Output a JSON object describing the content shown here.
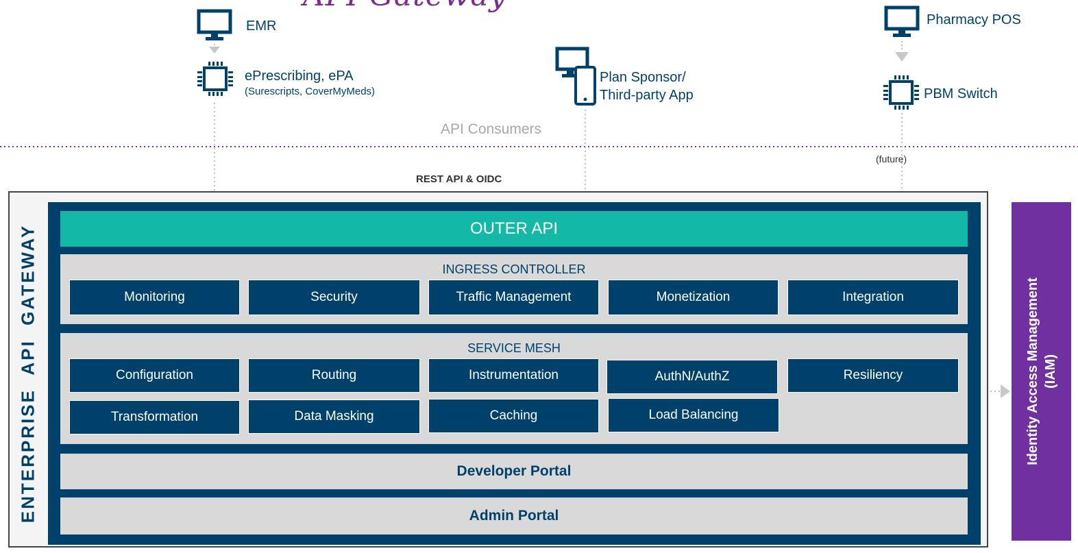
{
  "title": "API Gateway",
  "consumers": {
    "emr": "EMR",
    "eprescribing": "ePrescribing, ePA",
    "eprescribing_sub": "(Surescripts, CoverMyMeds)",
    "plan_sponsor_line1": "Plan Sponsor/",
    "plan_sponsor_line2": "Third-party App",
    "pharmacy_pos": "Pharmacy POS",
    "pbm_switch": "PBM Switch",
    "section_label": "API Consumers",
    "future_note": "(future)"
  },
  "rest_label": "REST API & OIDC",
  "gateway": {
    "vertical_label": "ENTERPRISE  API  GATEWAY",
    "outer_api": "OUTER API",
    "ingress": {
      "title": "INGRESS CONTROLLER",
      "items": [
        "Monitoring",
        "Security",
        "Traffic Management",
        "Monetization",
        "Integration"
      ]
    },
    "mesh": {
      "title": "SERVICE MESH",
      "items": [
        "Configuration",
        "Routing",
        "Instrumentation",
        "AuthN/AuthZ",
        "Resiliency",
        "Transformation",
        "Data Masking",
        "Caching",
        "Load Balancing"
      ]
    },
    "developer_portal": "Developer Portal",
    "admin_portal": "Admin Portal"
  },
  "iam": {
    "line1": "Identity Access Management",
    "line2": "(IAM)"
  },
  "colors": {
    "navy": "#00416b",
    "teal": "#14b8a6",
    "purple": "#7030a0",
    "title_purple": "#7a2d8c",
    "panel_gray": "#d9d9d9"
  }
}
